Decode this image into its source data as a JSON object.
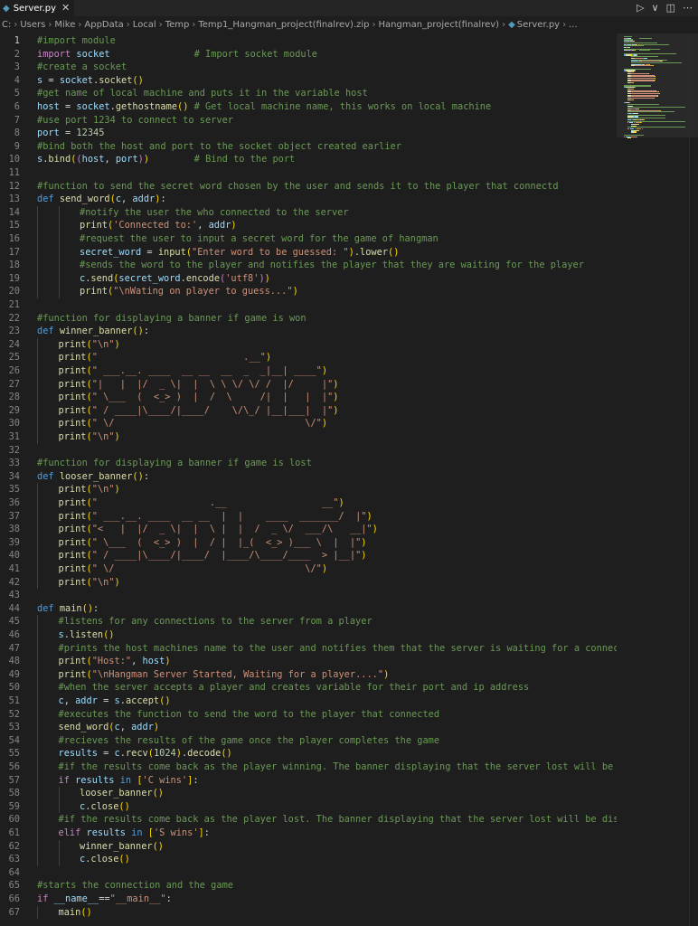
{
  "tab": {
    "label": "Server.py",
    "close": "✕"
  },
  "actions": {
    "run": "▷",
    "run_menu": "∨",
    "split": "◫",
    "more": "⋯"
  },
  "breadcrumbs": [
    "C:",
    "Users",
    "Mike",
    "AppData",
    "Local",
    "Temp",
    "Temp1_Hangman_project(finalrev).zip",
    "Hangman_project(finalrev)",
    "Server.py",
    "..."
  ],
  "active_line": 1,
  "lines": [
    {
      "n": 1,
      "i": 0,
      "t": [
        [
          "c",
          "#import module"
        ]
      ]
    },
    {
      "n": 2,
      "i": 0,
      "t": [
        [
          "k",
          "import"
        ],
        [
          "p",
          " "
        ],
        [
          "v",
          "socket"
        ],
        [
          "p",
          "               "
        ],
        [
          "c",
          "# Import socket module"
        ]
      ]
    },
    {
      "n": 3,
      "i": 0,
      "t": [
        [
          "c",
          "#create a socket"
        ]
      ]
    },
    {
      "n": 4,
      "i": 0,
      "t": [
        [
          "v",
          "s"
        ],
        [
          "p",
          " = "
        ],
        [
          "v",
          "socket"
        ],
        [
          "p",
          "."
        ],
        [
          "f",
          "socket"
        ],
        [
          "br",
          "()"
        ]
      ]
    },
    {
      "n": 5,
      "i": 0,
      "t": [
        [
          "c",
          "#get name of local machine and puts it in the variable host"
        ]
      ]
    },
    {
      "n": 6,
      "i": 0,
      "t": [
        [
          "v",
          "host"
        ],
        [
          "p",
          " = "
        ],
        [
          "v",
          "socket"
        ],
        [
          "p",
          "."
        ],
        [
          "f",
          "gethostname"
        ],
        [
          "br",
          "()"
        ],
        [
          "p",
          " "
        ],
        [
          "c",
          "# Get local machine name, this works on local machine"
        ]
      ]
    },
    {
      "n": 7,
      "i": 0,
      "t": [
        [
          "c",
          "#use port 1234 to connect to server"
        ]
      ]
    },
    {
      "n": 8,
      "i": 0,
      "t": [
        [
          "v",
          "port"
        ],
        [
          "p",
          " = "
        ],
        [
          "n",
          "12345"
        ]
      ]
    },
    {
      "n": 9,
      "i": 0,
      "t": [
        [
          "c",
          "#bind both the host and port to the socket object created earlier"
        ]
      ]
    },
    {
      "n": 10,
      "i": 0,
      "t": [
        [
          "v",
          "s"
        ],
        [
          "p",
          "."
        ],
        [
          "f",
          "bind"
        ],
        [
          "br",
          "("
        ],
        [
          "br2",
          "("
        ],
        [
          "v",
          "host"
        ],
        [
          "p",
          ", "
        ],
        [
          "v",
          "port"
        ],
        [
          "br2",
          ")"
        ],
        [
          "br",
          ")"
        ],
        [
          "p",
          "        "
        ],
        [
          "c",
          "# Bind to the port"
        ]
      ]
    },
    {
      "n": 11,
      "i": 0,
      "t": []
    },
    {
      "n": 12,
      "i": 0,
      "t": [
        [
          "c",
          "#function to send the secret word chosen by the user and sends it to the player that connectd"
        ]
      ]
    },
    {
      "n": 13,
      "i": 0,
      "t": [
        [
          "kb",
          "def"
        ],
        [
          "p",
          " "
        ],
        [
          "f",
          "send_word"
        ],
        [
          "br",
          "("
        ],
        [
          "v",
          "c"
        ],
        [
          "p",
          ", "
        ],
        [
          "v",
          "addr"
        ],
        [
          "br",
          ")"
        ],
        [
          "p",
          ":"
        ]
      ]
    },
    {
      "n": 14,
      "i": 2,
      "t": [
        [
          "c",
          "#notify the user the who connected to the server"
        ]
      ]
    },
    {
      "n": 15,
      "i": 2,
      "t": [
        [
          "f",
          "print"
        ],
        [
          "br",
          "("
        ],
        [
          "s",
          "'Connected to:'"
        ],
        [
          "p",
          ", "
        ],
        [
          "v",
          "addr"
        ],
        [
          "br",
          ")"
        ]
      ]
    },
    {
      "n": 16,
      "i": 2,
      "t": [
        [
          "c",
          "#request the user to input a secret word for the game of hangman"
        ]
      ]
    },
    {
      "n": 17,
      "i": 2,
      "t": [
        [
          "v",
          "secret_word"
        ],
        [
          "p",
          " = "
        ],
        [
          "f",
          "input"
        ],
        [
          "br",
          "("
        ],
        [
          "s",
          "\"Enter word to be guessed: \""
        ],
        [
          "br",
          ")"
        ],
        [
          "p",
          "."
        ],
        [
          "f",
          "lower"
        ],
        [
          "br",
          "()"
        ]
      ]
    },
    {
      "n": 18,
      "i": 2,
      "t": [
        [
          "c",
          "#sends the word to the player and notifies the player that they are waiting for the player"
        ]
      ]
    },
    {
      "n": 19,
      "i": 2,
      "t": [
        [
          "v",
          "c"
        ],
        [
          "p",
          "."
        ],
        [
          "f",
          "send"
        ],
        [
          "br",
          "("
        ],
        [
          "v",
          "secret_word"
        ],
        [
          "p",
          "."
        ],
        [
          "f",
          "encode"
        ],
        [
          "br2",
          "("
        ],
        [
          "s",
          "'utf8'"
        ],
        [
          "br2",
          ")"
        ],
        [
          "br",
          ")"
        ]
      ]
    },
    {
      "n": 20,
      "i": 2,
      "t": [
        [
          "f",
          "print"
        ],
        [
          "br",
          "("
        ],
        [
          "s",
          "\"\\nWating on player to guess...\""
        ],
        [
          "br",
          ")"
        ]
      ]
    },
    {
      "n": 21,
      "i": 0,
      "t": []
    },
    {
      "n": 22,
      "i": 0,
      "t": [
        [
          "c",
          "#function for displaying a banner if game is won"
        ]
      ]
    },
    {
      "n": 23,
      "i": 0,
      "t": [
        [
          "kb",
          "def"
        ],
        [
          "p",
          " "
        ],
        [
          "f",
          "winner_banner"
        ],
        [
          "br",
          "()"
        ],
        [
          "p",
          ":"
        ]
      ]
    },
    {
      "n": 24,
      "i": 1,
      "t": [
        [
          "f",
          "print"
        ],
        [
          "br",
          "("
        ],
        [
          "s",
          "\"\\n\""
        ],
        [
          "br",
          ")"
        ]
      ]
    },
    {
      "n": 25,
      "i": 1,
      "t": [
        [
          "f",
          "print"
        ],
        [
          "br",
          "("
        ],
        [
          "s",
          "\"                          .__\""
        ],
        [
          "br",
          ")"
        ]
      ]
    },
    {
      "n": 26,
      "i": 1,
      "t": [
        [
          "f",
          "print"
        ],
        [
          "br",
          "("
        ],
        [
          "s",
          "\" ___.__. ____  __ __  __  _  _|__| ____\""
        ],
        [
          "br",
          ")"
        ]
      ]
    },
    {
      "n": 27,
      "i": 1,
      "t": [
        [
          "f",
          "print"
        ],
        [
          "br",
          "("
        ],
        [
          "s",
          "\"|   |  |/  _ \\|  |  \\ \\ \\/ \\/ /  |/     |\""
        ],
        [
          "br",
          ")"
        ]
      ]
    },
    {
      "n": 28,
      "i": 1,
      "t": [
        [
          "f",
          "print"
        ],
        [
          "br",
          "("
        ],
        [
          "s",
          "\" \\___  (  <_> )  |  /  \\     /|  |   |  |\""
        ],
        [
          "br",
          ")"
        ]
      ]
    },
    {
      "n": 29,
      "i": 1,
      "t": [
        [
          "f",
          "print"
        ],
        [
          "br",
          "("
        ],
        [
          "s",
          "\" / ____|\\____/|____/    \\/\\_/ |__|___|  |\""
        ],
        [
          "br",
          ")"
        ]
      ]
    },
    {
      "n": 30,
      "i": 1,
      "t": [
        [
          "f",
          "print"
        ],
        [
          "br",
          "("
        ],
        [
          "s",
          "\" \\/                                  \\/\""
        ],
        [
          "br",
          ")"
        ]
      ]
    },
    {
      "n": 31,
      "i": 1,
      "t": [
        [
          "f",
          "print"
        ],
        [
          "br",
          "("
        ],
        [
          "s",
          "\"\\n\""
        ],
        [
          "br",
          ")"
        ]
      ]
    },
    {
      "n": 32,
      "i": 0,
      "t": []
    },
    {
      "n": 33,
      "i": 0,
      "t": [
        [
          "c",
          "#function for displaying a banner if game is lost"
        ]
      ]
    },
    {
      "n": 34,
      "i": 0,
      "t": [
        [
          "kb",
          "def"
        ],
        [
          "p",
          " "
        ],
        [
          "f",
          "looser_banner"
        ],
        [
          "br",
          "()"
        ],
        [
          "p",
          ":"
        ]
      ]
    },
    {
      "n": 35,
      "i": 1,
      "t": [
        [
          "f",
          "print"
        ],
        [
          "br",
          "("
        ],
        [
          "s",
          "\"\\n\""
        ],
        [
          "br",
          ")"
        ]
      ]
    },
    {
      "n": 36,
      "i": 1,
      "t": [
        [
          "f",
          "print"
        ],
        [
          "br",
          "("
        ],
        [
          "s",
          "\"                    .__                 __\""
        ],
        [
          "br",
          ")"
        ]
      ]
    },
    {
      "n": 37,
      "i": 1,
      "t": [
        [
          "f",
          "print"
        ],
        [
          "br",
          "("
        ],
        [
          "s",
          "\" ___.__. ____  __ __  |  |    ____  _______/  |\""
        ],
        [
          "br",
          ")"
        ]
      ]
    },
    {
      "n": 38,
      "i": 1,
      "t": [
        [
          "f",
          "print"
        ],
        [
          "br",
          "("
        ],
        [
          "s",
          "\"<   |  |/  _ \\|  |  \\ |  |  /  _ \\/  ___/\\   __|\""
        ],
        [
          "br",
          ")"
        ]
      ]
    },
    {
      "n": 39,
      "i": 1,
      "t": [
        [
          "f",
          "print"
        ],
        [
          "br",
          "("
        ],
        [
          "s",
          "\" \\___  (  <_> )  |  / |  |_(  <_> )___ \\  |  |\""
        ],
        [
          "br",
          ")"
        ]
      ]
    },
    {
      "n": 40,
      "i": 1,
      "t": [
        [
          "f",
          "print"
        ],
        [
          "br",
          "("
        ],
        [
          "s",
          "\" / ____|\\____/|____/  |____/\\____/____  > |__|\""
        ],
        [
          "br",
          ")"
        ]
      ]
    },
    {
      "n": 41,
      "i": 1,
      "t": [
        [
          "f",
          "print"
        ],
        [
          "br",
          "("
        ],
        [
          "s",
          "\" \\/                                  \\/\""
        ],
        [
          "br",
          ")"
        ]
      ]
    },
    {
      "n": 42,
      "i": 1,
      "t": [
        [
          "f",
          "print"
        ],
        [
          "br",
          "("
        ],
        [
          "s",
          "\"\\n\""
        ],
        [
          "br",
          ")"
        ]
      ]
    },
    {
      "n": 43,
      "i": 0,
      "t": []
    },
    {
      "n": 44,
      "i": 0,
      "t": [
        [
          "kb",
          "def"
        ],
        [
          "p",
          " "
        ],
        [
          "f",
          "main"
        ],
        [
          "br",
          "()"
        ],
        [
          "p",
          ":"
        ]
      ]
    },
    {
      "n": 45,
      "i": 1,
      "t": [
        [
          "c",
          "#listens for any connections to the server from a player"
        ]
      ]
    },
    {
      "n": 46,
      "i": 1,
      "t": [
        [
          "v",
          "s"
        ],
        [
          "p",
          "."
        ],
        [
          "f",
          "listen"
        ],
        [
          "br",
          "()"
        ]
      ]
    },
    {
      "n": 47,
      "i": 1,
      "t": [
        [
          "c",
          "#prints the host machines name to the user and notifies them that the server is waiting for a connection"
        ]
      ]
    },
    {
      "n": 48,
      "i": 1,
      "t": [
        [
          "f",
          "print"
        ],
        [
          "br",
          "("
        ],
        [
          "s",
          "\"Host:\""
        ],
        [
          "p",
          ", "
        ],
        [
          "v",
          "host"
        ],
        [
          "br",
          ")"
        ]
      ]
    },
    {
      "n": 49,
      "i": 1,
      "t": [
        [
          "f",
          "print"
        ],
        [
          "br",
          "("
        ],
        [
          "s",
          "\"\\nHangman Server Started, Waiting for a player....\""
        ],
        [
          "br",
          ")"
        ]
      ]
    },
    {
      "n": 50,
      "i": 1,
      "t": [
        [
          "c",
          "#when the server accepts a player and creates variable for their port and ip address"
        ]
      ]
    },
    {
      "n": 51,
      "i": 1,
      "t": [
        [
          "v",
          "c"
        ],
        [
          "p",
          ", "
        ],
        [
          "v",
          "addr"
        ],
        [
          "p",
          " = "
        ],
        [
          "v",
          "s"
        ],
        [
          "p",
          "."
        ],
        [
          "f",
          "accept"
        ],
        [
          "br",
          "()"
        ]
      ]
    },
    {
      "n": 52,
      "i": 1,
      "t": [
        [
          "c",
          "#executes the function to send the word to the player that connected"
        ]
      ]
    },
    {
      "n": 53,
      "i": 1,
      "t": [
        [
          "f",
          "send_word"
        ],
        [
          "br",
          "("
        ],
        [
          "v",
          "c"
        ],
        [
          "p",
          ", "
        ],
        [
          "v",
          "addr"
        ],
        [
          "br",
          ")"
        ]
      ]
    },
    {
      "n": 54,
      "i": 1,
      "t": [
        [
          "c",
          "#recieves the results of the game once the player completes the game"
        ]
      ]
    },
    {
      "n": 55,
      "i": 1,
      "t": [
        [
          "v",
          "results"
        ],
        [
          "p",
          " = "
        ],
        [
          "v",
          "c"
        ],
        [
          "p",
          "."
        ],
        [
          "f",
          "recv"
        ],
        [
          "br",
          "("
        ],
        [
          "n",
          "1024"
        ],
        [
          "br",
          ")"
        ],
        [
          "p",
          "."
        ],
        [
          "f",
          "decode"
        ],
        [
          "br",
          "()"
        ]
      ]
    },
    {
      "n": 56,
      "i": 1,
      "t": [
        [
          "c",
          "#if the results come back as the player winning. The banner displaying that the server lost will be disp"
        ]
      ]
    },
    {
      "n": 57,
      "i": 1,
      "t": [
        [
          "k",
          "if"
        ],
        [
          "p",
          " "
        ],
        [
          "v",
          "results"
        ],
        [
          "p",
          " "
        ],
        [
          "kb",
          "in"
        ],
        [
          "p",
          " "
        ],
        [
          "br",
          "["
        ],
        [
          "s",
          "'C wins'"
        ],
        [
          "br",
          "]"
        ],
        [
          "p",
          ":"
        ]
      ]
    },
    {
      "n": 58,
      "i": 2,
      "t": [
        [
          "f",
          "looser_banner"
        ],
        [
          "br",
          "()"
        ]
      ]
    },
    {
      "n": 59,
      "i": 2,
      "t": [
        [
          "v",
          "c"
        ],
        [
          "p",
          "."
        ],
        [
          "f",
          "close"
        ],
        [
          "br",
          "()"
        ]
      ]
    },
    {
      "n": 60,
      "i": 1,
      "t": [
        [
          "c",
          "#if the results come back as the player lost. The banner displaying that the server lost will be display"
        ]
      ]
    },
    {
      "n": 61,
      "i": 1,
      "t": [
        [
          "k",
          "elif"
        ],
        [
          "p",
          " "
        ],
        [
          "v",
          "results"
        ],
        [
          "p",
          " "
        ],
        [
          "kb",
          "in"
        ],
        [
          "p",
          " "
        ],
        [
          "br",
          "["
        ],
        [
          "s",
          "'S wins'"
        ],
        [
          "br",
          "]"
        ],
        [
          "p",
          ":"
        ]
      ]
    },
    {
      "n": 62,
      "i": 2,
      "t": [
        [
          "f",
          "winner_banner"
        ],
        [
          "br",
          "()"
        ]
      ]
    },
    {
      "n": 63,
      "i": 2,
      "t": [
        [
          "v",
          "c"
        ],
        [
          "p",
          "."
        ],
        [
          "f",
          "close"
        ],
        [
          "br",
          "()"
        ]
      ]
    },
    {
      "n": 64,
      "i": 0,
      "t": []
    },
    {
      "n": 65,
      "i": 0,
      "t": [
        [
          "c",
          "#starts the connection and the game"
        ]
      ]
    },
    {
      "n": 66,
      "i": 0,
      "t": [
        [
          "k",
          "if"
        ],
        [
          "p",
          " "
        ],
        [
          "v",
          "__name__"
        ],
        [
          "p",
          "=="
        ],
        [
          "s",
          "\"__main__\""
        ],
        [
          "p",
          ":"
        ]
      ]
    },
    {
      "n": 67,
      "i": 1,
      "t": [
        [
          "f",
          "main"
        ],
        [
          "br",
          "()"
        ]
      ]
    }
  ]
}
